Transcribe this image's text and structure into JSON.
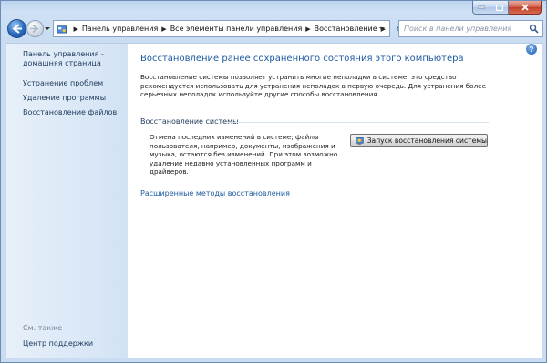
{
  "window": {
    "caption_colors": {
      "close": "#c2402a",
      "frame": "#c9dcf1"
    }
  },
  "address_bar": {
    "crumbs": [
      "Панель управления",
      "Все элементы панели управления",
      "Восстановление"
    ]
  },
  "search": {
    "placeholder": "Поиск в панели управления"
  },
  "sidebar": {
    "home_label": "Панель управления - домашняя страница",
    "items": [
      {
        "label": "Устранение проблем"
      },
      {
        "label": "Удаление программы"
      },
      {
        "label": "Восстановление файлов"
      }
    ],
    "see_also_label": "См. также",
    "support_label": "Центр поддержки"
  },
  "main": {
    "title": "Восстановление ранее сохраненного состояния этого компьютера",
    "intro": "Восстановление системы позволяет устранить многие неполадки в системе; это средство рекомендуется использовать для устранения неполадок в первую очередь. Для устранения более серьезных неполадок используйте другие способы восстановления.",
    "section_title": "Восстановление системы",
    "section_desc": "Отмена последних изменений в системе; файлы пользователя, например, документы, изображения и музыка, остаются без изменений. При этом возможно удаление недавно установленных программ и драйверов.",
    "restore_button": "Запуск восстановления системы",
    "advanced_link": "Расширенные методы восстановления",
    "help_glyph": "?"
  },
  "colors": {
    "link": "#1e5aa0",
    "title": "#1e5aa0",
    "nav_text": "#1e395b"
  }
}
